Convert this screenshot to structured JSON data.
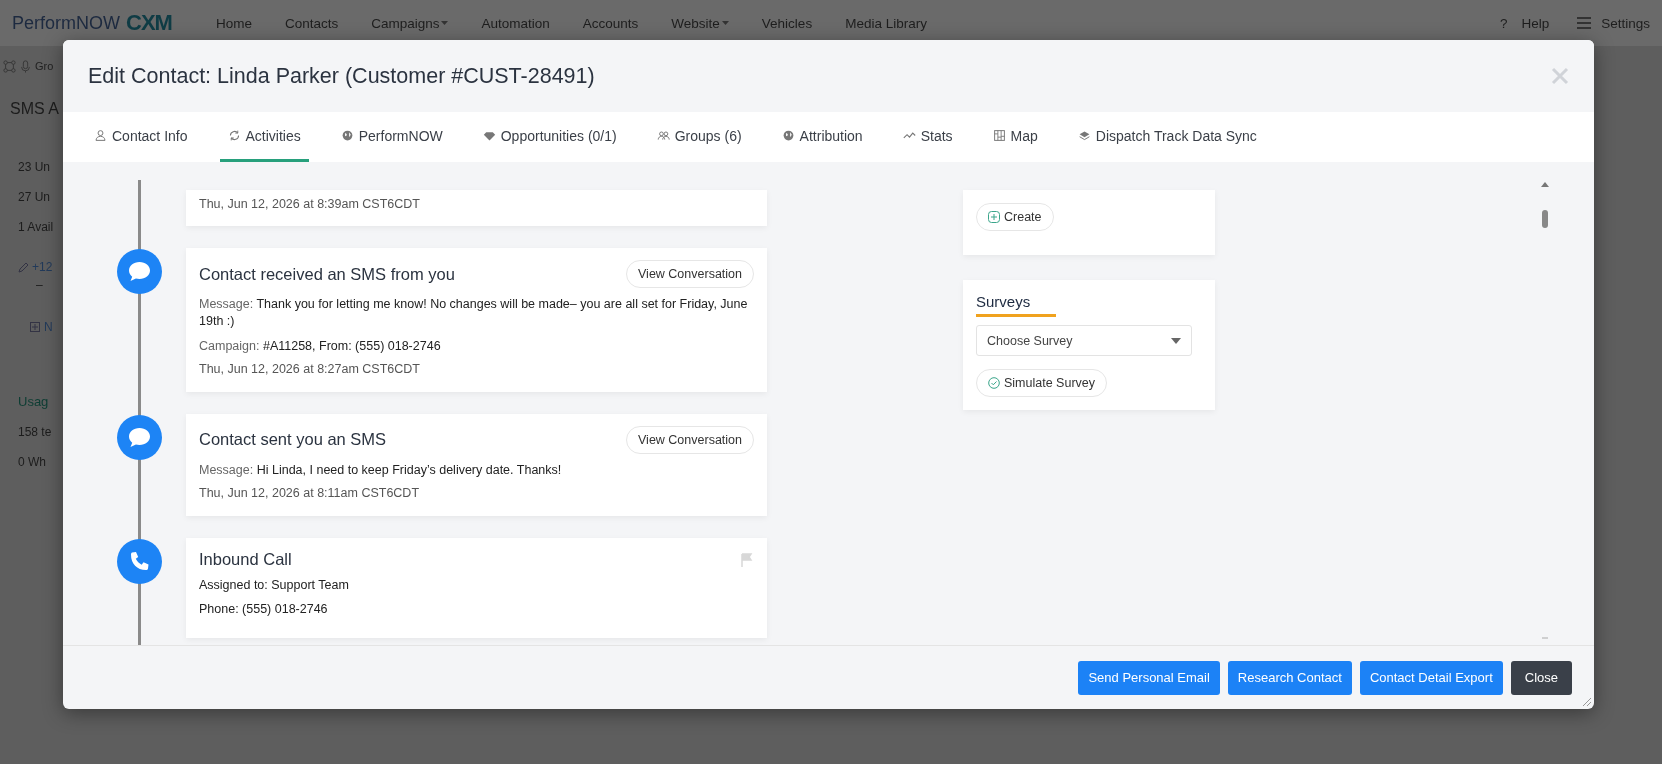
{
  "top_nav": {
    "logo": {
      "text": "PerformNOW",
      "badge": "CXM"
    },
    "items": [
      {
        "label": "Home",
        "dropdown": false
      },
      {
        "label": "Contacts",
        "dropdown": false
      },
      {
        "label": "Campaigns",
        "dropdown": true
      },
      {
        "label": "Automation",
        "dropdown": false
      },
      {
        "label": "Accounts",
        "dropdown": false
      },
      {
        "label": "Website",
        "dropdown": true
      },
      {
        "label": "Vehicles",
        "dropdown": false
      },
      {
        "label": "Media Library",
        "dropdown": false
      }
    ],
    "help": {
      "icon": "?",
      "label": "Help"
    },
    "settings": {
      "label": "Settings"
    }
  },
  "background_page": {
    "toolbar_label": "Gro",
    "title": "SMS A",
    "stats": [
      "23 Un",
      "27 Un",
      "1 Avail"
    ],
    "phone": "+12",
    "phone_note": "–",
    "new_link": "N",
    "usage_title": "Usag",
    "usage_stats": [
      "158 te",
      "0 Wh"
    ]
  },
  "modal": {
    "title": "Edit Contact: Linda Parker (Customer #CUST-28491)",
    "tabs": [
      {
        "label": "Contact Info",
        "selected": false
      },
      {
        "label": "Activities",
        "selected": true
      },
      {
        "label": "PerformNOW",
        "selected": false
      },
      {
        "label": "Opportunities (0/1)",
        "selected": false
      },
      {
        "label": "Groups (6)",
        "selected": false
      },
      {
        "label": "Attribution",
        "selected": false
      },
      {
        "label": "Stats",
        "selected": false
      },
      {
        "label": "Map",
        "selected": false
      },
      {
        "label": "Dispatch Track Data Sync",
        "selected": false
      }
    ],
    "timeline": [
      {
        "kind": "note",
        "date": "Thu, Jun 12, 2026 at 8:39am CST6CDT"
      },
      {
        "kind": "sms",
        "title": "Contact received an SMS from you",
        "button": "View Conversation",
        "lines": [
          {
            "label": "Message:",
            "value": "Thank you for letting me know! No changes will be made– you are all set for Friday, June 19th :)"
          },
          {
            "label": "Campaign:",
            "value": "#A11258, From: (555) 018-2746"
          }
        ],
        "date": "Thu, Jun 12, 2026 at 8:27am CST6CDT"
      },
      {
        "kind": "sms",
        "title": "Contact sent you an SMS",
        "button": "View Conversation",
        "lines": [
          {
            "label": "Message:",
            "value": "Hi Linda, I need to keep Friday’s delivery date. Thanks!"
          }
        ],
        "date": "Thu, Jun 12, 2026 at 8:11am CST6CDT"
      },
      {
        "kind": "call",
        "title": "Inbound Call",
        "flagged": false,
        "lines": [
          {
            "value": "Assigned to: Support Team"
          },
          {
            "value": "Phone: (555) 018-2746"
          }
        ]
      }
    ],
    "side_panel": {
      "create_button": "Create",
      "surveys": {
        "title": "Surveys",
        "select": {
          "placeholder": "Choose Survey"
        },
        "simulate_button": "Simulate Survey"
      }
    },
    "footer_buttons": [
      {
        "label": "Send Personal Email",
        "kind": "primary"
      },
      {
        "label": "Research Contact",
        "kind": "primary"
      },
      {
        "label": "Contact Detail Export",
        "kind": "primary"
      },
      {
        "label": "Close",
        "kind": "dark"
      }
    ]
  }
}
